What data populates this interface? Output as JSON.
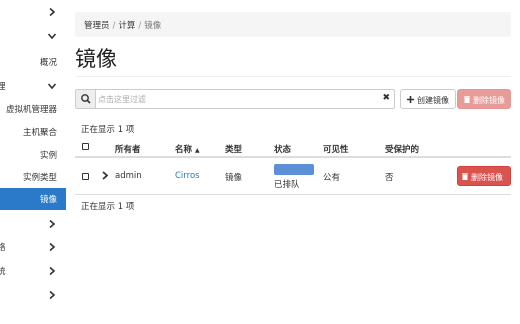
{
  "sidebar": {
    "items": [
      {
        "label": "",
        "icon": "chevron-right-icon"
      },
      {
        "label": "",
        "icon": "chevron-down-icon"
      },
      {
        "label": "概况"
      },
      {
        "label": "理",
        "icon": "chevron-down-icon"
      },
      {
        "label": "虚拟机管理器"
      },
      {
        "label": "主机聚合"
      },
      {
        "label": "实例"
      },
      {
        "label": "实例类型"
      },
      {
        "label": "镜像",
        "active": true
      },
      {
        "label": "",
        "icon": "chevron-right-icon"
      },
      {
        "label": "络",
        "icon": "chevron-right-icon"
      },
      {
        "label": "统",
        "icon": "chevron-right-icon"
      },
      {
        "label": "",
        "icon": "chevron-right-icon"
      }
    ],
    "active_color": "#2b7ac9"
  },
  "breadcrumb": {
    "items": [
      "管理员",
      "计算"
    ],
    "current": "镜像",
    "separator": "/"
  },
  "page_title": "镜像",
  "filter": {
    "placeholder": "点击这里过滤",
    "value": "",
    "clear_icon": "✖"
  },
  "actions": {
    "create_label": "创建镜像",
    "delete_label": "删除镜像"
  },
  "count_top": "正在显示 1 项",
  "count_bottom": "正在显示 1 项",
  "table": {
    "columns": [
      "所有者",
      "名称",
      "类型",
      "状态",
      "可见性",
      "受保护的"
    ],
    "sort_indicator": "▲",
    "rows": [
      {
        "owner": "admin",
        "name": "Cirros",
        "type": "镜像",
        "status": "已排队",
        "status_progress": 1.0,
        "visibility": "公有",
        "protected": "否",
        "action": "删除镜像"
      }
    ]
  },
  "colors": {
    "danger": "#d9534f",
    "link": "#2a7ab8",
    "progress": "#5b8fd6"
  }
}
